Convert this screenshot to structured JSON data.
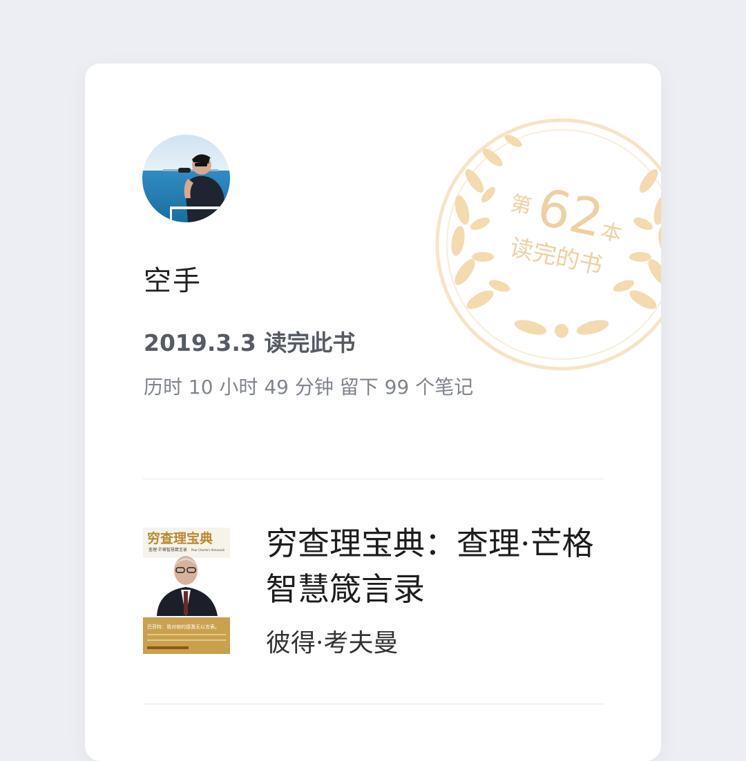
{
  "profile": {
    "username": "空手",
    "finish_date": "2019.3.3",
    "finish_text": "读完此书",
    "stats_text": "历时 10 小时 49 分钟 留下 99 个笔记"
  },
  "badge": {
    "prefix": "第",
    "number": "62",
    "suffix": "本",
    "caption": "读完的书",
    "color": "#f1d3a0"
  },
  "book": {
    "title": "穷查理宝典：查理·芒格智慧箴言录",
    "author": "彼得·考夫曼",
    "cover": {
      "title": "穷查理宝典",
      "subtitle": "查理·芒格智慧箴言录",
      "english": "Poor Charlie's Almanack",
      "quote": "巴菲特：我对他的感激无以言表。"
    }
  }
}
